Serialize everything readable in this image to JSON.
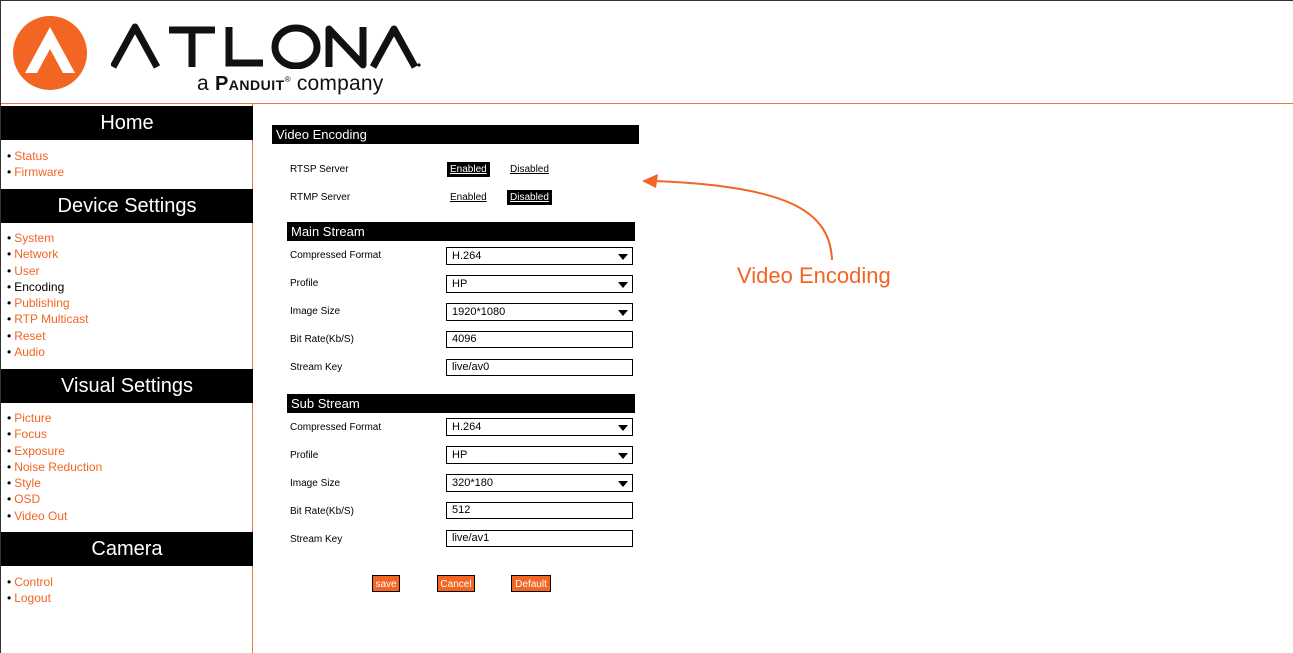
{
  "header": {
    "logo_word": "ATLONA",
    "tagline_prefix": "a",
    "tagline_brand": "Panduit",
    "tagline_suffix": "company"
  },
  "sidebar": {
    "sections": [
      {
        "title": "Home",
        "items": [
          "Status",
          "Firmware"
        ]
      },
      {
        "title": "Device Settings",
        "items": [
          "System",
          "Network",
          "User",
          "Encoding",
          "Publishing",
          "RTP Multicast",
          "Reset",
          "Audio"
        ]
      },
      {
        "title": "Visual Settings",
        "items": [
          "Picture",
          "Focus",
          "Exposure",
          "Noise Reduction",
          "Style",
          "OSD",
          "Video Out"
        ]
      },
      {
        "title": "Camera",
        "items": [
          "Control",
          "Logout"
        ]
      }
    ],
    "active_item": "Encoding"
  },
  "main": {
    "section_title": "Video Encoding",
    "rtsp": {
      "label": "RTSP Server",
      "enabled": "Enabled",
      "disabled": "Disabled",
      "state": "Enabled"
    },
    "rtmp": {
      "label": "RTMP Server",
      "enabled": "Enabled",
      "disabled": "Disabled",
      "state": "Disabled"
    },
    "main_stream": {
      "title": "Main Stream",
      "compressed_format_label": "Compressed Format",
      "compressed_format": "H.264",
      "profile_label": "Profile",
      "profile": "HP",
      "image_size_label": "Image Size",
      "image_size": "1920*1080",
      "bit_rate_label": "Bit Rate(Kb/S)",
      "bit_rate": "4096",
      "stream_key_label": "Stream Key",
      "stream_key": "live/av0"
    },
    "sub_stream": {
      "title": "Sub Stream",
      "compressed_format_label": "Compressed Format",
      "compressed_format": "H.264",
      "profile_label": "Profile",
      "profile": "HP",
      "image_size_label": "Image Size",
      "image_size": "320*180",
      "bit_rate_label": "Bit Rate(Kb/S)",
      "bit_rate": "512",
      "stream_key_label": "Stream Key",
      "stream_key": "live/av1"
    },
    "buttons": {
      "save": "save",
      "cancel": "Cancel",
      "default": "Default"
    }
  },
  "annotation": {
    "text": "Video Encoding"
  },
  "colors": {
    "accent": "#f26522",
    "dark": "#000000"
  }
}
